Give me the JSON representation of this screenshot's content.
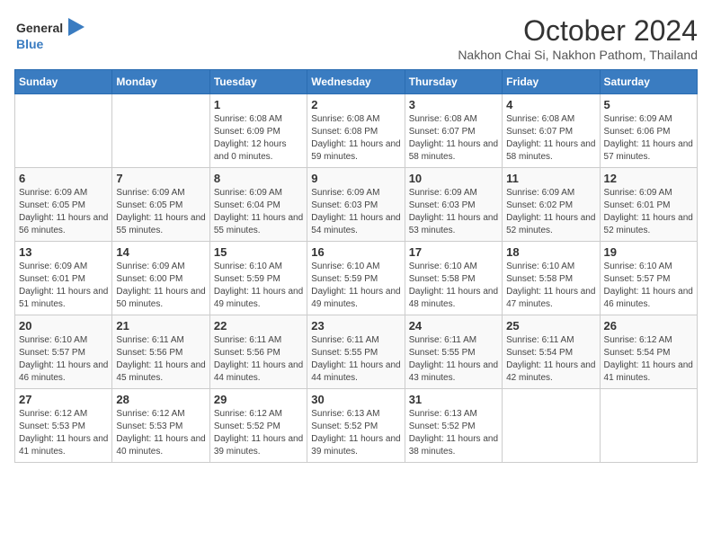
{
  "logo": {
    "line1": "General",
    "line2": "Blue"
  },
  "title": "October 2024",
  "subtitle": "Nakhon Chai Si, Nakhon Pathom, Thailand",
  "weekdays": [
    "Sunday",
    "Monday",
    "Tuesday",
    "Wednesday",
    "Thursday",
    "Friday",
    "Saturday"
  ],
  "weeks": [
    [
      {
        "day": "",
        "info": ""
      },
      {
        "day": "",
        "info": ""
      },
      {
        "day": "1",
        "info": "Sunrise: 6:08 AM\nSunset: 6:09 PM\nDaylight: 12 hours\nand 0 minutes."
      },
      {
        "day": "2",
        "info": "Sunrise: 6:08 AM\nSunset: 6:08 PM\nDaylight: 11 hours\nand 59 minutes."
      },
      {
        "day": "3",
        "info": "Sunrise: 6:08 AM\nSunset: 6:07 PM\nDaylight: 11 hours\nand 58 minutes."
      },
      {
        "day": "4",
        "info": "Sunrise: 6:08 AM\nSunset: 6:07 PM\nDaylight: 11 hours\nand 58 minutes."
      },
      {
        "day": "5",
        "info": "Sunrise: 6:09 AM\nSunset: 6:06 PM\nDaylight: 11 hours\nand 57 minutes."
      }
    ],
    [
      {
        "day": "6",
        "info": "Sunrise: 6:09 AM\nSunset: 6:05 PM\nDaylight: 11 hours\nand 56 minutes."
      },
      {
        "day": "7",
        "info": "Sunrise: 6:09 AM\nSunset: 6:05 PM\nDaylight: 11 hours\nand 55 minutes."
      },
      {
        "day": "8",
        "info": "Sunrise: 6:09 AM\nSunset: 6:04 PM\nDaylight: 11 hours\nand 55 minutes."
      },
      {
        "day": "9",
        "info": "Sunrise: 6:09 AM\nSunset: 6:03 PM\nDaylight: 11 hours\nand 54 minutes."
      },
      {
        "day": "10",
        "info": "Sunrise: 6:09 AM\nSunset: 6:03 PM\nDaylight: 11 hours\nand 53 minutes."
      },
      {
        "day": "11",
        "info": "Sunrise: 6:09 AM\nSunset: 6:02 PM\nDaylight: 11 hours\nand 52 minutes."
      },
      {
        "day": "12",
        "info": "Sunrise: 6:09 AM\nSunset: 6:01 PM\nDaylight: 11 hours\nand 52 minutes."
      }
    ],
    [
      {
        "day": "13",
        "info": "Sunrise: 6:09 AM\nSunset: 6:01 PM\nDaylight: 11 hours\nand 51 minutes."
      },
      {
        "day": "14",
        "info": "Sunrise: 6:09 AM\nSunset: 6:00 PM\nDaylight: 11 hours\nand 50 minutes."
      },
      {
        "day": "15",
        "info": "Sunrise: 6:10 AM\nSunset: 5:59 PM\nDaylight: 11 hours\nand 49 minutes."
      },
      {
        "day": "16",
        "info": "Sunrise: 6:10 AM\nSunset: 5:59 PM\nDaylight: 11 hours\nand 49 minutes."
      },
      {
        "day": "17",
        "info": "Sunrise: 6:10 AM\nSunset: 5:58 PM\nDaylight: 11 hours\nand 48 minutes."
      },
      {
        "day": "18",
        "info": "Sunrise: 6:10 AM\nSunset: 5:58 PM\nDaylight: 11 hours\nand 47 minutes."
      },
      {
        "day": "19",
        "info": "Sunrise: 6:10 AM\nSunset: 5:57 PM\nDaylight: 11 hours\nand 46 minutes."
      }
    ],
    [
      {
        "day": "20",
        "info": "Sunrise: 6:10 AM\nSunset: 5:57 PM\nDaylight: 11 hours\nand 46 minutes."
      },
      {
        "day": "21",
        "info": "Sunrise: 6:11 AM\nSunset: 5:56 PM\nDaylight: 11 hours\nand 45 minutes."
      },
      {
        "day": "22",
        "info": "Sunrise: 6:11 AM\nSunset: 5:56 PM\nDaylight: 11 hours\nand 44 minutes."
      },
      {
        "day": "23",
        "info": "Sunrise: 6:11 AM\nSunset: 5:55 PM\nDaylight: 11 hours\nand 44 minutes."
      },
      {
        "day": "24",
        "info": "Sunrise: 6:11 AM\nSunset: 5:55 PM\nDaylight: 11 hours\nand 43 minutes."
      },
      {
        "day": "25",
        "info": "Sunrise: 6:11 AM\nSunset: 5:54 PM\nDaylight: 11 hours\nand 42 minutes."
      },
      {
        "day": "26",
        "info": "Sunrise: 6:12 AM\nSunset: 5:54 PM\nDaylight: 11 hours\nand 41 minutes."
      }
    ],
    [
      {
        "day": "27",
        "info": "Sunrise: 6:12 AM\nSunset: 5:53 PM\nDaylight: 11 hours\nand 41 minutes."
      },
      {
        "day": "28",
        "info": "Sunrise: 6:12 AM\nSunset: 5:53 PM\nDaylight: 11 hours\nand 40 minutes."
      },
      {
        "day": "29",
        "info": "Sunrise: 6:12 AM\nSunset: 5:52 PM\nDaylight: 11 hours\nand 39 minutes."
      },
      {
        "day": "30",
        "info": "Sunrise: 6:13 AM\nSunset: 5:52 PM\nDaylight: 11 hours\nand 39 minutes."
      },
      {
        "day": "31",
        "info": "Sunrise: 6:13 AM\nSunset: 5:52 PM\nDaylight: 11 hours\nand 38 minutes."
      },
      {
        "day": "",
        "info": ""
      },
      {
        "day": "",
        "info": ""
      }
    ]
  ]
}
